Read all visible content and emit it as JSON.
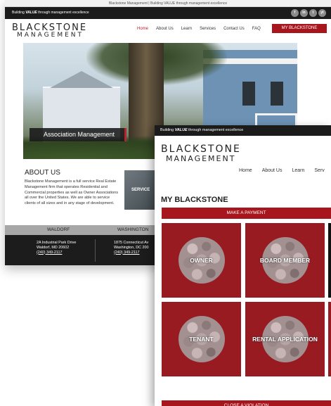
{
  "back_window": {
    "title_bar": "Blackstone Management | Building VALUE through management excellence",
    "top_bar": {
      "prefix": "Building ",
      "emphasis": "VALUE",
      "suffix": " through management excellence"
    },
    "social_icons": [
      "f",
      "in",
      "t",
      "yt"
    ],
    "logo": {
      "line1": "BLACKSTONE",
      "line2": "MANAGEMENT"
    },
    "nav": [
      "Home",
      "About Us",
      "Learn",
      "Services",
      "Contact Us",
      "FAQ"
    ],
    "active_nav": "Home",
    "cta_button": "MY BLACKSTONE",
    "hero_caption": "Association Management",
    "about": {
      "heading": "ABOUT US",
      "body": "Blackstone Management is a full service Real Estate Management firm that operates Residential and Commercial properties as well as Owner Associations all over the United States. We are able to service clients of all sizes and in any stage of development."
    },
    "service_tile": "SERVICE",
    "locations": [
      {
        "name": "WALDORF",
        "line1": "2A Industrial Park Drive",
        "line2": "Waldorf, MD 20602",
        "phone": "(240) 349-2117"
      },
      {
        "name": "WASHINGTON",
        "line1": "1875 Connecticut Av",
        "line2": "Washington, DC 200",
        "phone": "(240) 349-2117"
      }
    ]
  },
  "front_window": {
    "top_bar": {
      "prefix": "Building ",
      "emphasis": "VALUE",
      "suffix": " through management excellence"
    },
    "logo": {
      "line1": "BLACKSTONE",
      "line2": "MANAGEMENT"
    },
    "nav": [
      "Home",
      "About Us",
      "Learn",
      "Serv"
    ],
    "page_title": "MY BLACKSTONE",
    "payment_button": "MAKE A PAYMENT",
    "tiles": [
      "OWNER",
      "BOARD MEMBER",
      "TENANT",
      "RENTAL APPLICATION"
    ],
    "violation_button": "CLOSE A VIOLATION"
  },
  "colors": {
    "brand_red": "#a8161d",
    "tile_red": "#981b22",
    "dark": "#1b1b1b"
  }
}
